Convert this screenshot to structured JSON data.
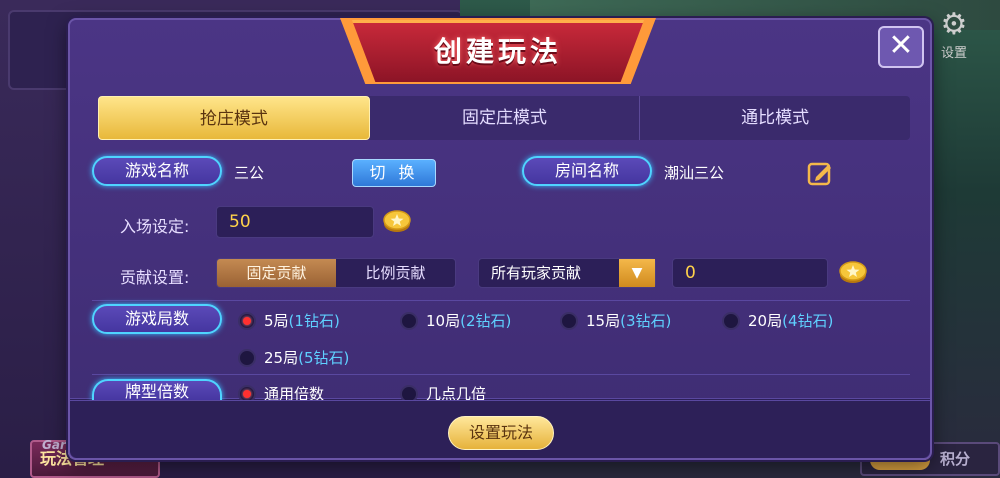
{
  "background": {
    "settings_label": "设置",
    "bottom_left_small": "Gar",
    "bottom_left_label": "玩法管理",
    "bottom_right_label": "积分"
  },
  "dialog": {
    "title": "创建玩法",
    "close_glyph": "✕",
    "tabs": [
      {
        "label": "抢庄模式",
        "active": true
      },
      {
        "label": "固定庄模式",
        "active": false
      },
      {
        "label": "通比模式",
        "active": false
      }
    ],
    "game_name_label": "游戏名称",
    "game_name_value": "三公",
    "switch_label": "切 换",
    "room_name_label": "房间名称",
    "room_name_value": "潮汕三公",
    "entry_label": "入场设定:",
    "entry_value": "50",
    "contribution_label": "贡献设置:",
    "contribution_options": [
      "固定贡献",
      "比例贡献"
    ],
    "contribution_selected": "固定贡献",
    "contribution_scope": "所有玩家贡献",
    "contribution_value": "0",
    "rounds_label": "游戏局数",
    "rounds": [
      {
        "label": "5局",
        "cost": "(1钻石)",
        "selected": true
      },
      {
        "label": "10局",
        "cost": "(2钻石)",
        "selected": false
      },
      {
        "label": "15局",
        "cost": "(3钻石)",
        "selected": false
      },
      {
        "label": "20局",
        "cost": "(4钻石)",
        "selected": false
      },
      {
        "label": "25局",
        "cost": "(5钻石)",
        "selected": false
      }
    ],
    "multiplier_label": "牌型倍数",
    "multipliers": [
      {
        "label": "通用倍数",
        "selected": true
      },
      {
        "label": "几点几倍",
        "selected": false
      }
    ],
    "submit_label": "设置玩法"
  },
  "colors": {
    "dialog_bg": "#4b3585",
    "accent_gold": "#e8b83a",
    "title_red": "#c8293a",
    "cost_blue": "#5fd0ff",
    "pill_glow": "#4fd4ff"
  }
}
